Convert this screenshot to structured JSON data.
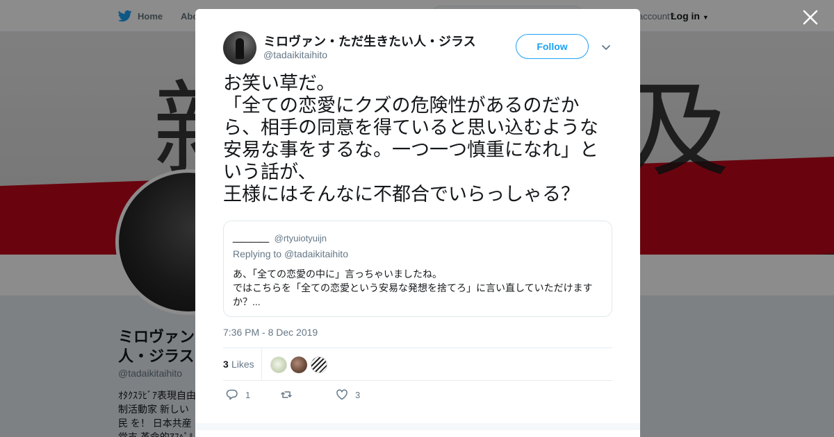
{
  "nav": {
    "home_label": "Home",
    "about_label": "Abo",
    "account_prompt": "account?",
    "login_label": "Log in"
  },
  "banner": {
    "kanji_left": "新",
    "kanji_right": "及"
  },
  "profile": {
    "name": "ミロヴァン・ただ生きたい人・ジラス",
    "name_visible": "ミロヴァン 人・ジラス",
    "handle": "@tadaikitaihito",
    "bio_visible": "ｵﾀｸｽﾗﾋﾞｱ表現自由 制活動家 新しい民 を！ 日本共産党支 革命的ｱｽﾍﾟﾙｶﾞﾝｾﾞ"
  },
  "tweet": {
    "author_name": "ミロヴァン・ただ生きたい人・ジラス",
    "author_handle": "@tadaikitaihito",
    "follow_label": "Follow",
    "text_lines": [
      "お笑い草だ。",
      "「全ての恋愛にクズの危険性があるのだか",
      "ら、相手の同意を得ていると思い込むような",
      "安易な事をするな。一つ一つ慎重になれ」と",
      "いう話が、",
      "王様にはそんなに不都合でいらっしゃる？"
    ],
    "quote": {
      "name": "＿＿＿＿",
      "handle": "@rtyuiotyuijn",
      "replying_prefix": "Replying to",
      "replying_to": "@tadaikitaihito",
      "body_lines": [
        "あ、「全ての恋愛の中に」言っちゃいましたね。",
        "ではこちらを「全ての恋愛という安易な発想を捨てろ」に言い直していただけます",
        "か？..."
      ]
    },
    "timestamp": "7:36 PM - 8 Dec 2019",
    "likes_count": "3",
    "likes_label": "Likes",
    "reply_count": "1",
    "retweet_count": "",
    "like_count": "3"
  },
  "colors": {
    "brand_blue": "#1da1f2",
    "text_primary": "#14171a",
    "text_secondary": "#657786",
    "banner_red": "#c0081a"
  },
  "icons": {
    "logo": "twitter-bird-icon",
    "close": "close-icon",
    "caret": "chevron-down-icon",
    "reply": "reply-icon",
    "retweet": "retweet-icon",
    "like": "heart-icon"
  }
}
